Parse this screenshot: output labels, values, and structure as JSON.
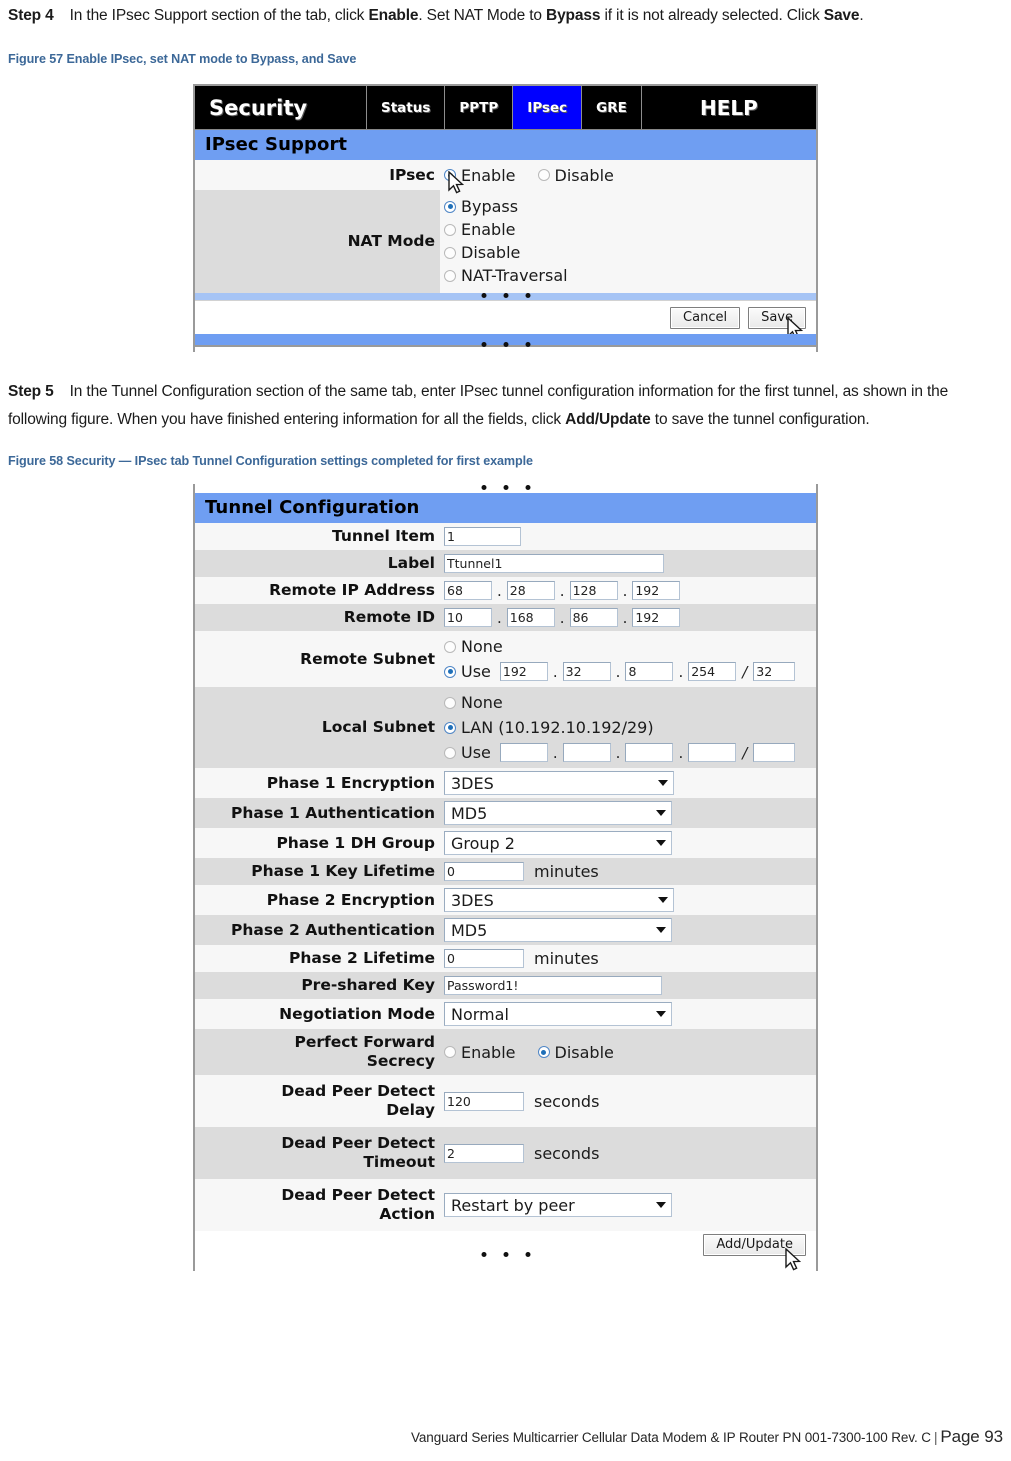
{
  "step4": {
    "label": "Step 4",
    "text_a": "In the IPsec Support section of the tab, click ",
    "bold_a": "Enable",
    "text_b": ". Set NAT Mode to ",
    "bold_b": "Bypass",
    "text_c": " if it is not already selected. Click ",
    "bold_c": "Save",
    "text_d": "."
  },
  "figure57": {
    "caption": "Figure 57 Enable IPsec, set NAT mode to Bypass, and Save",
    "nav": [
      {
        "label": "Security",
        "style": "brand",
        "active": false
      },
      {
        "label": "Status",
        "style": "small",
        "active": false
      },
      {
        "label": "PPTP",
        "style": "small",
        "active": false
      },
      {
        "label": "IPsec",
        "style": "small",
        "active": true
      },
      {
        "label": "GRE",
        "style": "small",
        "active": false
      },
      {
        "label": "HELP",
        "style": "help",
        "active": false
      }
    ],
    "section_title": "IPsec Support",
    "ipsec_label": "IPsec",
    "ipsec_options": [
      {
        "label": "Enable",
        "selected": true
      },
      {
        "label": "Disable",
        "selected": false
      }
    ],
    "nat_label": "NAT Mode",
    "nat_options": [
      {
        "label": "Bypass",
        "selected": true
      },
      {
        "label": "Enable",
        "selected": false
      },
      {
        "label": "Disable",
        "selected": false
      },
      {
        "label": "NAT-Traversal",
        "selected": false
      }
    ],
    "cancel_label": "Cancel",
    "save_label": "Save"
  },
  "step5": {
    "label": "Step 5",
    "text_a": "In the Tunnel Configuration section of the same tab, enter IPsec tunnel configuration information for the first tunnel, as shown in the following figure. When you have finished entering information for all the fields, click ",
    "bold_a": "Add/Update",
    "text_b": " to save the tunnel configuration."
  },
  "figure58": {
    "caption": "Figure 58 Security — IPsec tab Tunnel Configuration settings completed for first example",
    "section_title": "Tunnel Configuration",
    "tunnel_item": {
      "label": "Tunnel Item",
      "value": "1"
    },
    "tunnel_label": {
      "label": "Label",
      "value": "Ttunnel1"
    },
    "remote_ip": {
      "label": "Remote IP Address",
      "octets": [
        "68",
        "28",
        "128",
        "192"
      ]
    },
    "remote_id": {
      "label": "Remote ID",
      "octets": [
        "10",
        "168",
        "86",
        "192"
      ]
    },
    "remote_subnet": {
      "label": "Remote Subnet",
      "none_label": "None",
      "none_selected": false,
      "use_label": "Use",
      "use_selected": true,
      "octets": [
        "192",
        "32",
        "8",
        "254"
      ],
      "mask": "32"
    },
    "local_subnet": {
      "label": "Local Subnet",
      "none_label": "None",
      "none_selected": false,
      "lan_label": "LAN (10.192.10.192/29)",
      "lan_selected": true,
      "use_label": "Use",
      "use_selected": false,
      "octets": [
        "",
        "",
        "",
        ""
      ],
      "mask": ""
    },
    "p1_encryption": {
      "label": "Phase 1 Encryption",
      "value": "3DES"
    },
    "p1_auth": {
      "label": "Phase 1 Authentication",
      "value": "MD5"
    },
    "p1_dh": {
      "label": "Phase 1 DH Group",
      "value": "Group 2"
    },
    "p1_keylife": {
      "label": "Phase 1 Key Lifetime",
      "value": "0",
      "unit": "minutes"
    },
    "p2_encryption": {
      "label": "Phase 2 Encryption",
      "value": "3DES"
    },
    "p2_auth": {
      "label": "Phase 2 Authentication",
      "value": "MD5"
    },
    "p2_lifetime": {
      "label": "Phase 2 Lifetime",
      "value": "0",
      "unit": "minutes"
    },
    "psk": {
      "label": "Pre-shared Key",
      "value": "Password1!"
    },
    "negotiation": {
      "label": "Negotiation Mode",
      "value": "Normal"
    },
    "pfs": {
      "label_line1": "Perfect Forward",
      "label_line2": "Secrecy",
      "options": [
        {
          "label": "Enable",
          "selected": false
        },
        {
          "label": "Disable",
          "selected": true
        }
      ]
    },
    "dpd_delay": {
      "label_line1": "Dead Peer Detect",
      "label_line2": "Delay",
      "value": "120",
      "unit": "seconds"
    },
    "dpd_timeout": {
      "label_line1": "Dead Peer Detect",
      "label_line2": "Timeout",
      "value": "2",
      "unit": "seconds"
    },
    "dpd_action": {
      "label_line1": "Dead Peer Detect",
      "label_line2": "Action",
      "value": "Restart by peer"
    },
    "add_update_label": "Add/Update"
  },
  "footer": {
    "text": "Vanguard Series Multicarrier Cellular Data Modem & IP Router PN 001-7300-100 Rev. C",
    "separator": "|",
    "page": "Page 93"
  }
}
